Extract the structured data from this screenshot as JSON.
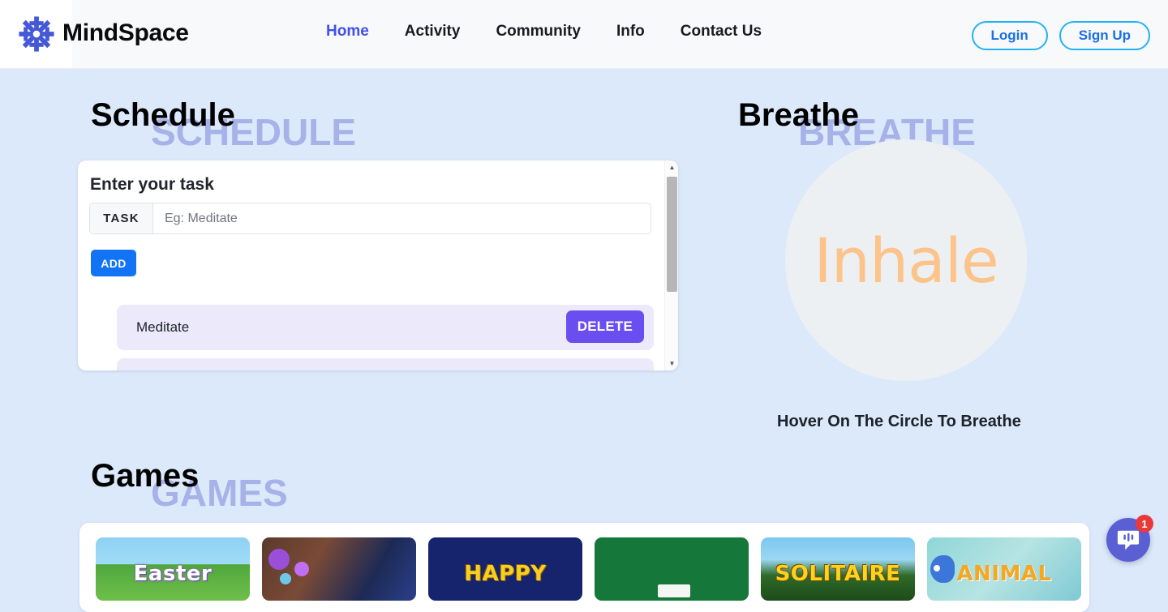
{
  "header": {
    "brand": "MindSpace",
    "logo_icon": "snowflake-icon",
    "nav": [
      {
        "label": "Home",
        "active": true
      },
      {
        "label": "Activity",
        "active": false
      },
      {
        "label": "Community",
        "active": false
      },
      {
        "label": "Info",
        "active": false
      },
      {
        "label": "Contact Us",
        "active": false
      }
    ],
    "login_label": "Login",
    "signup_label": "Sign Up"
  },
  "schedule": {
    "heading": "Schedule",
    "ghost_heading": "SCHEDULE",
    "card_title": "Enter your task",
    "input_addon": "TASK",
    "input_placeholder": "Eg: Meditate",
    "input_value": "",
    "add_label": "ADD",
    "delete_label": "DELETE",
    "tasks": [
      {
        "name": "Meditate"
      },
      {
        "name": ""
      }
    ]
  },
  "breathe": {
    "heading": "Breathe",
    "ghost_heading": "BREATHE",
    "state_word": "Inhale",
    "hint": "Hover On The Circle To Breathe",
    "circle_color": "#edf0f2",
    "word_color": "#fcc38a"
  },
  "games": {
    "heading": "Games",
    "ghost_heading": "GAMES",
    "items": [
      {
        "label": "Easter",
        "theme": "g-easter"
      },
      {
        "label": "",
        "theme": "g-monster"
      },
      {
        "label": "HAPPY",
        "theme": "g-happy"
      },
      {
        "label": "",
        "theme": "g-green"
      },
      {
        "label": "SOLITAIRE",
        "theme": "g-solitaire"
      },
      {
        "label": "ANIMAL",
        "theme": "g-animal"
      }
    ]
  },
  "chat": {
    "icon": "chat-bubble-icon",
    "badge_count": "1"
  },
  "colors": {
    "page_bg": "#dce9fb",
    "header_bg": "#f8f9fa",
    "accent_blue": "#4050e8",
    "add_blue": "#1273f5",
    "delete_purple": "#6a4ef0",
    "ghost_purple": "#a7b2e8",
    "task_row": "#ece9fb"
  }
}
